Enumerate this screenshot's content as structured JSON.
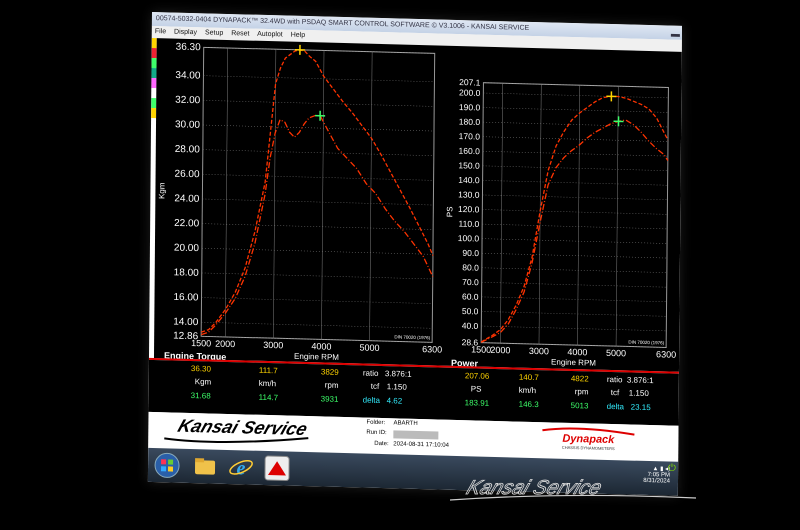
{
  "window": {
    "title": "00574-5032-0404 DYNAPACK™ 32.4WD with PSDAQ SMART CONTROL SOFTWARE © V3.1006 - KANSAI SERVICE"
  },
  "menu": [
    "File",
    "Display",
    "Setup",
    "Reset",
    "Autoplot",
    "Help"
  ],
  "colors": {
    "curve": "#ff3300",
    "marker_peak": "#ffd400",
    "marker_alt": "#3dff6a",
    "grid": "#808080",
    "accent": "#d00000"
  },
  "chart_data": [
    {
      "type": "line",
      "title": "Engine Torque",
      "xlabel": "Engine RPM",
      "ylabel": "Kgm",
      "note": "DIN 70020 (1976)",
      "xlim": [
        1500,
        6300
      ],
      "ylim": [
        12.86,
        36.3
      ],
      "x_ticks": [
        "1500",
        "2000",
        "3000",
        "4000",
        "5000",
        "6300"
      ],
      "y_ticks": [
        "36.30",
        "34.00",
        "32.00",
        "30.00",
        "28.00",
        "26.00",
        "24.00",
        "22.00",
        "20.00",
        "18.00",
        "16.00",
        "14.00",
        "12.86"
      ],
      "series": [
        {
          "style": "dashed",
          "x": [
            1500,
            1650,
            1800,
            2000,
            2200,
            2400,
            2600,
            2800,
            3000,
            3100,
            3200,
            3400,
            3500,
            3600,
            3700,
            3829,
            4000,
            4200,
            4400,
            4600,
            4800,
            5000,
            5200,
            5400,
            5600,
            5800,
            6000,
            6200,
            6300
          ],
          "y": [
            13.2,
            13.4,
            14.0,
            15.1,
            16.5,
            18.5,
            21.5,
            25.5,
            33.5,
            34.8,
            35.6,
            36.2,
            36.3,
            36.2,
            35.8,
            35.4,
            34.2,
            33.2,
            32.2,
            31.3,
            30.3,
            29.3,
            28.0,
            26.6,
            25.2,
            23.8,
            22.3,
            20.8,
            19.9
          ]
        },
        {
          "style": "dash-dot",
          "x": [
            1500,
            1650,
            1800,
            2000,
            2200,
            2400,
            2600,
            2800,
            2900,
            3000,
            3100,
            3200,
            3300,
            3400,
            3500,
            3600,
            3700,
            3829,
            3931,
            4100,
            4300,
            4500,
            4700,
            4900,
            5100,
            5300,
            5500,
            5700,
            5900,
            6100,
            6300
          ],
          "y": [
            13.0,
            13.2,
            13.8,
            14.8,
            16.0,
            17.8,
            20.5,
            24.5,
            27.5,
            29.5,
            30.6,
            30.4,
            29.6,
            29.2,
            29.6,
            30.3,
            30.8,
            31.0,
            31.0,
            29.8,
            28.4,
            27.6,
            26.8,
            25.6,
            24.8,
            23.6,
            22.6,
            21.8,
            20.8,
            19.8,
            18.2
          ]
        }
      ],
      "markers": [
        {
          "x": 3500,
          "y": 36.3,
          "color": "yellow"
        },
        {
          "x": 3931,
          "y": 31.0,
          "color": "green"
        }
      ]
    },
    {
      "type": "line",
      "title": "Power",
      "xlabel": "Engine RPM",
      "ylabel": "PS",
      "note": "DIN 70020 (1976)",
      "xlim": [
        1500,
        6300
      ],
      "ylim": [
        28.6,
        207.1
      ],
      "x_ticks": [
        "1500",
        "2000",
        "3000",
        "4000",
        "5000",
        "6300"
      ],
      "y_ticks": [
        "207.1",
        "200.0",
        "190.0",
        "180.0",
        "170.0",
        "160.0",
        "150.0",
        "140.0",
        "130.0",
        "120.0",
        "110.0",
        "100.0",
        "90.0",
        "80.0",
        "70.0",
        "60.0",
        "50.0",
        "40.0",
        "28.6"
      ],
      "series": [
        {
          "style": "dashed",
          "x": [
            1500,
            1800,
            2000,
            2200,
            2400,
            2600,
            2800,
            3000,
            3200,
            3400,
            3600,
            3800,
            4000,
            4200,
            4400,
            4600,
            4822,
            5000,
            5200,
            5400,
            5600,
            5800,
            6000,
            6200,
            6300
          ],
          "y": [
            29.0,
            34.0,
            38.0,
            45.0,
            55.0,
            68.0,
            88.0,
            120.0,
            148.0,
            165.0,
            175.0,
            183.0,
            188.0,
            192.0,
            196.0,
            199.0,
            200.0,
            200.0,
            199.0,
            197.0,
            195.0,
            192.0,
            186.0,
            176.0,
            171.0
          ]
        },
        {
          "style": "dash-dot",
          "x": [
            1500,
            1800,
            2000,
            2200,
            2400,
            2600,
            2800,
            3000,
            3200,
            3400,
            3600,
            3800,
            4000,
            4200,
            4400,
            4600,
            4800,
            5013,
            5200,
            5400,
            5600,
            5800,
            6000,
            6200,
            6300
          ],
          "y": [
            28.8,
            33.0,
            36.0,
            42.0,
            52.0,
            64.0,
            84.0,
            112.0,
            138.0,
            150.0,
            157.0,
            162.0,
            166.0,
            171.0,
            175.0,
            178.0,
            181.0,
            183.0,
            184.0,
            181.0,
            176.0,
            170.0,
            165.0,
            161.0,
            157.0
          ]
        }
      ],
      "markers": [
        {
          "x": 4822,
          "y": 200.0,
          "color": "yellow"
        },
        {
          "x": 5013,
          "y": 183.0,
          "color": "green"
        }
      ]
    }
  ],
  "torque_panel": {
    "heading": "Engine Torque",
    "peak": "36.30",
    "unit": "Kgm",
    "alt": "31.68",
    "speed_peak": "111.7",
    "speed_unit": "km/h",
    "speed_alt": "114.7",
    "rpm_peak": "3829",
    "rpm_unit": "rpm",
    "rpm_alt": "3931",
    "ratio_label": "ratio",
    "ratio": "3.876:1",
    "tcf_label": "tcf",
    "tcf": "1.150",
    "delta_label": "delta",
    "delta": "4.62"
  },
  "power_panel": {
    "heading": "Power",
    "peak": "207.06",
    "unit": "PS",
    "alt": "183.91",
    "speed_peak": "140.7",
    "speed_unit": "km/h",
    "speed_alt": "146.3",
    "rpm_peak": "4822",
    "rpm_unit": "rpm",
    "rpm_alt": "5013",
    "ratio_label": "ratio",
    "ratio": "3.876:1",
    "tcf_label": "tcf",
    "tcf": "1.150",
    "delta_label": "delta",
    "delta": "23.15"
  },
  "info": {
    "folder_label": "Folder:",
    "folder": "ABARTH",
    "runid_label": "Run ID:",
    "date_label": "Date:",
    "date": "2024-08-31 17:10:04"
  },
  "logos": {
    "dynapack": "Dynapack",
    "dynapack_tag": "CHASSIS DYNAMOMETERS",
    "kansai": "Kansai Service"
  },
  "tray": {
    "time": "7:05 PM",
    "date": "8/31/2024"
  },
  "watermark": "Kansai Service"
}
